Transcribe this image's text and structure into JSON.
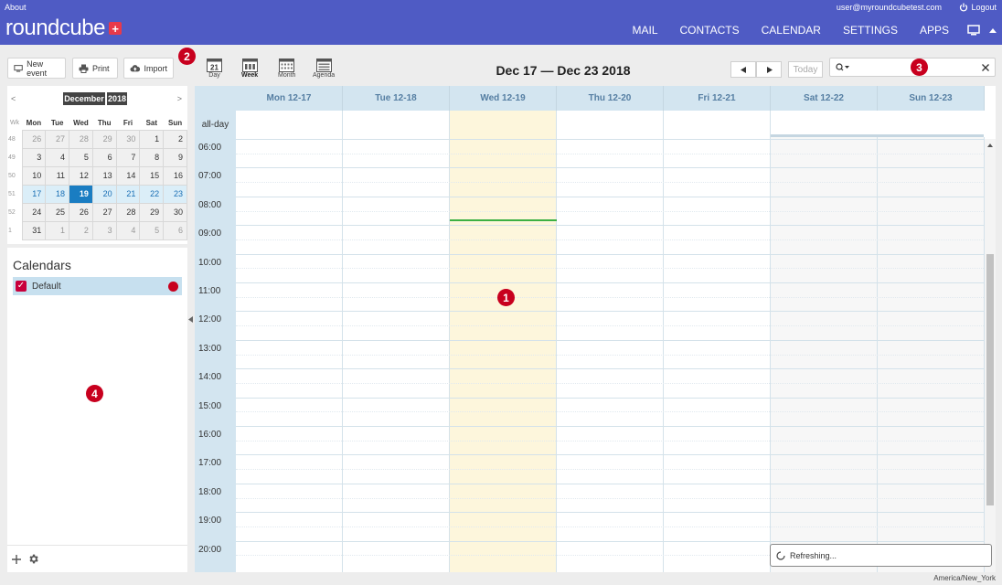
{
  "header": {
    "about": "About",
    "user_email": "user@myroundcubetest.com",
    "logout": "Logout",
    "logo_text": "roundcube",
    "logo_plus": "+",
    "nav": [
      {
        "label": "MAIL"
      },
      {
        "label": "CONTACTS"
      },
      {
        "label": "CALENDAR"
      },
      {
        "label": "SETTINGS"
      },
      {
        "label": "APPS"
      }
    ]
  },
  "toolbar": {
    "new_event": "New event",
    "print": "Print",
    "import": "Import"
  },
  "views": [
    {
      "label": "Day",
      "icon": "day-view-icon",
      "icon_text": "21"
    },
    {
      "label": "Week",
      "icon": "week-view-icon"
    },
    {
      "label": "Month",
      "icon": "month-view-icon"
    },
    {
      "label": "Agenda",
      "icon": "agenda-view-icon"
    }
  ],
  "active_view": "Week",
  "date_range": "Dec 17 — Dec 23 2018",
  "today_button": "Today",
  "badges": [
    "1",
    "2",
    "3",
    "4"
  ],
  "mini_calendar": {
    "month": "December",
    "year": "2018",
    "prev": "<",
    "next": ">",
    "headers": [
      "Wk",
      "Mon",
      "Tue",
      "Wed",
      "Thu",
      "Fri",
      "Sat",
      "Sun"
    ],
    "weeks": [
      {
        "wk": "48",
        "days": [
          "26",
          "27",
          "28",
          "29",
          "30",
          "1",
          "2"
        ]
      },
      {
        "wk": "49",
        "days": [
          "3",
          "4",
          "5",
          "6",
          "7",
          "8",
          "9"
        ]
      },
      {
        "wk": "50",
        "days": [
          "10",
          "11",
          "12",
          "13",
          "14",
          "15",
          "16"
        ]
      },
      {
        "wk": "51",
        "days": [
          "17",
          "18",
          "19",
          "20",
          "21",
          "22",
          "23"
        ]
      },
      {
        "wk": "52",
        "days": [
          "24",
          "25",
          "26",
          "27",
          "28",
          "29",
          "30"
        ]
      },
      {
        "wk": "1",
        "days": [
          "31",
          "1",
          "2",
          "3",
          "4",
          "5",
          "6"
        ]
      }
    ],
    "today": "19"
  },
  "calendars": {
    "title": "Calendars",
    "items": [
      {
        "name": "Default",
        "color": "#c8001e"
      }
    ]
  },
  "week_grid": {
    "days": [
      "Mon 12-17",
      "Tue 12-18",
      "Wed 12-19",
      "Thu 12-20",
      "Fri 12-21",
      "Sat 12-22",
      "Sun 12-23"
    ],
    "allday_label": "all-day",
    "hours": [
      "06:00",
      "07:00",
      "08:00",
      "09:00",
      "10:00",
      "11:00",
      "12:00",
      "13:00",
      "14:00",
      "15:00",
      "16:00",
      "17:00",
      "18:00",
      "19:00",
      "20:00"
    ],
    "today_index": 2
  },
  "status": {
    "message": "Refreshing..."
  },
  "timezone": "America/New_York",
  "colors": {
    "header": "#4f5bc4",
    "accent": "#1a7dc2",
    "today_bg": "#fdf6dc",
    "now_line": "#3cb043",
    "badge": "#c8001e"
  }
}
